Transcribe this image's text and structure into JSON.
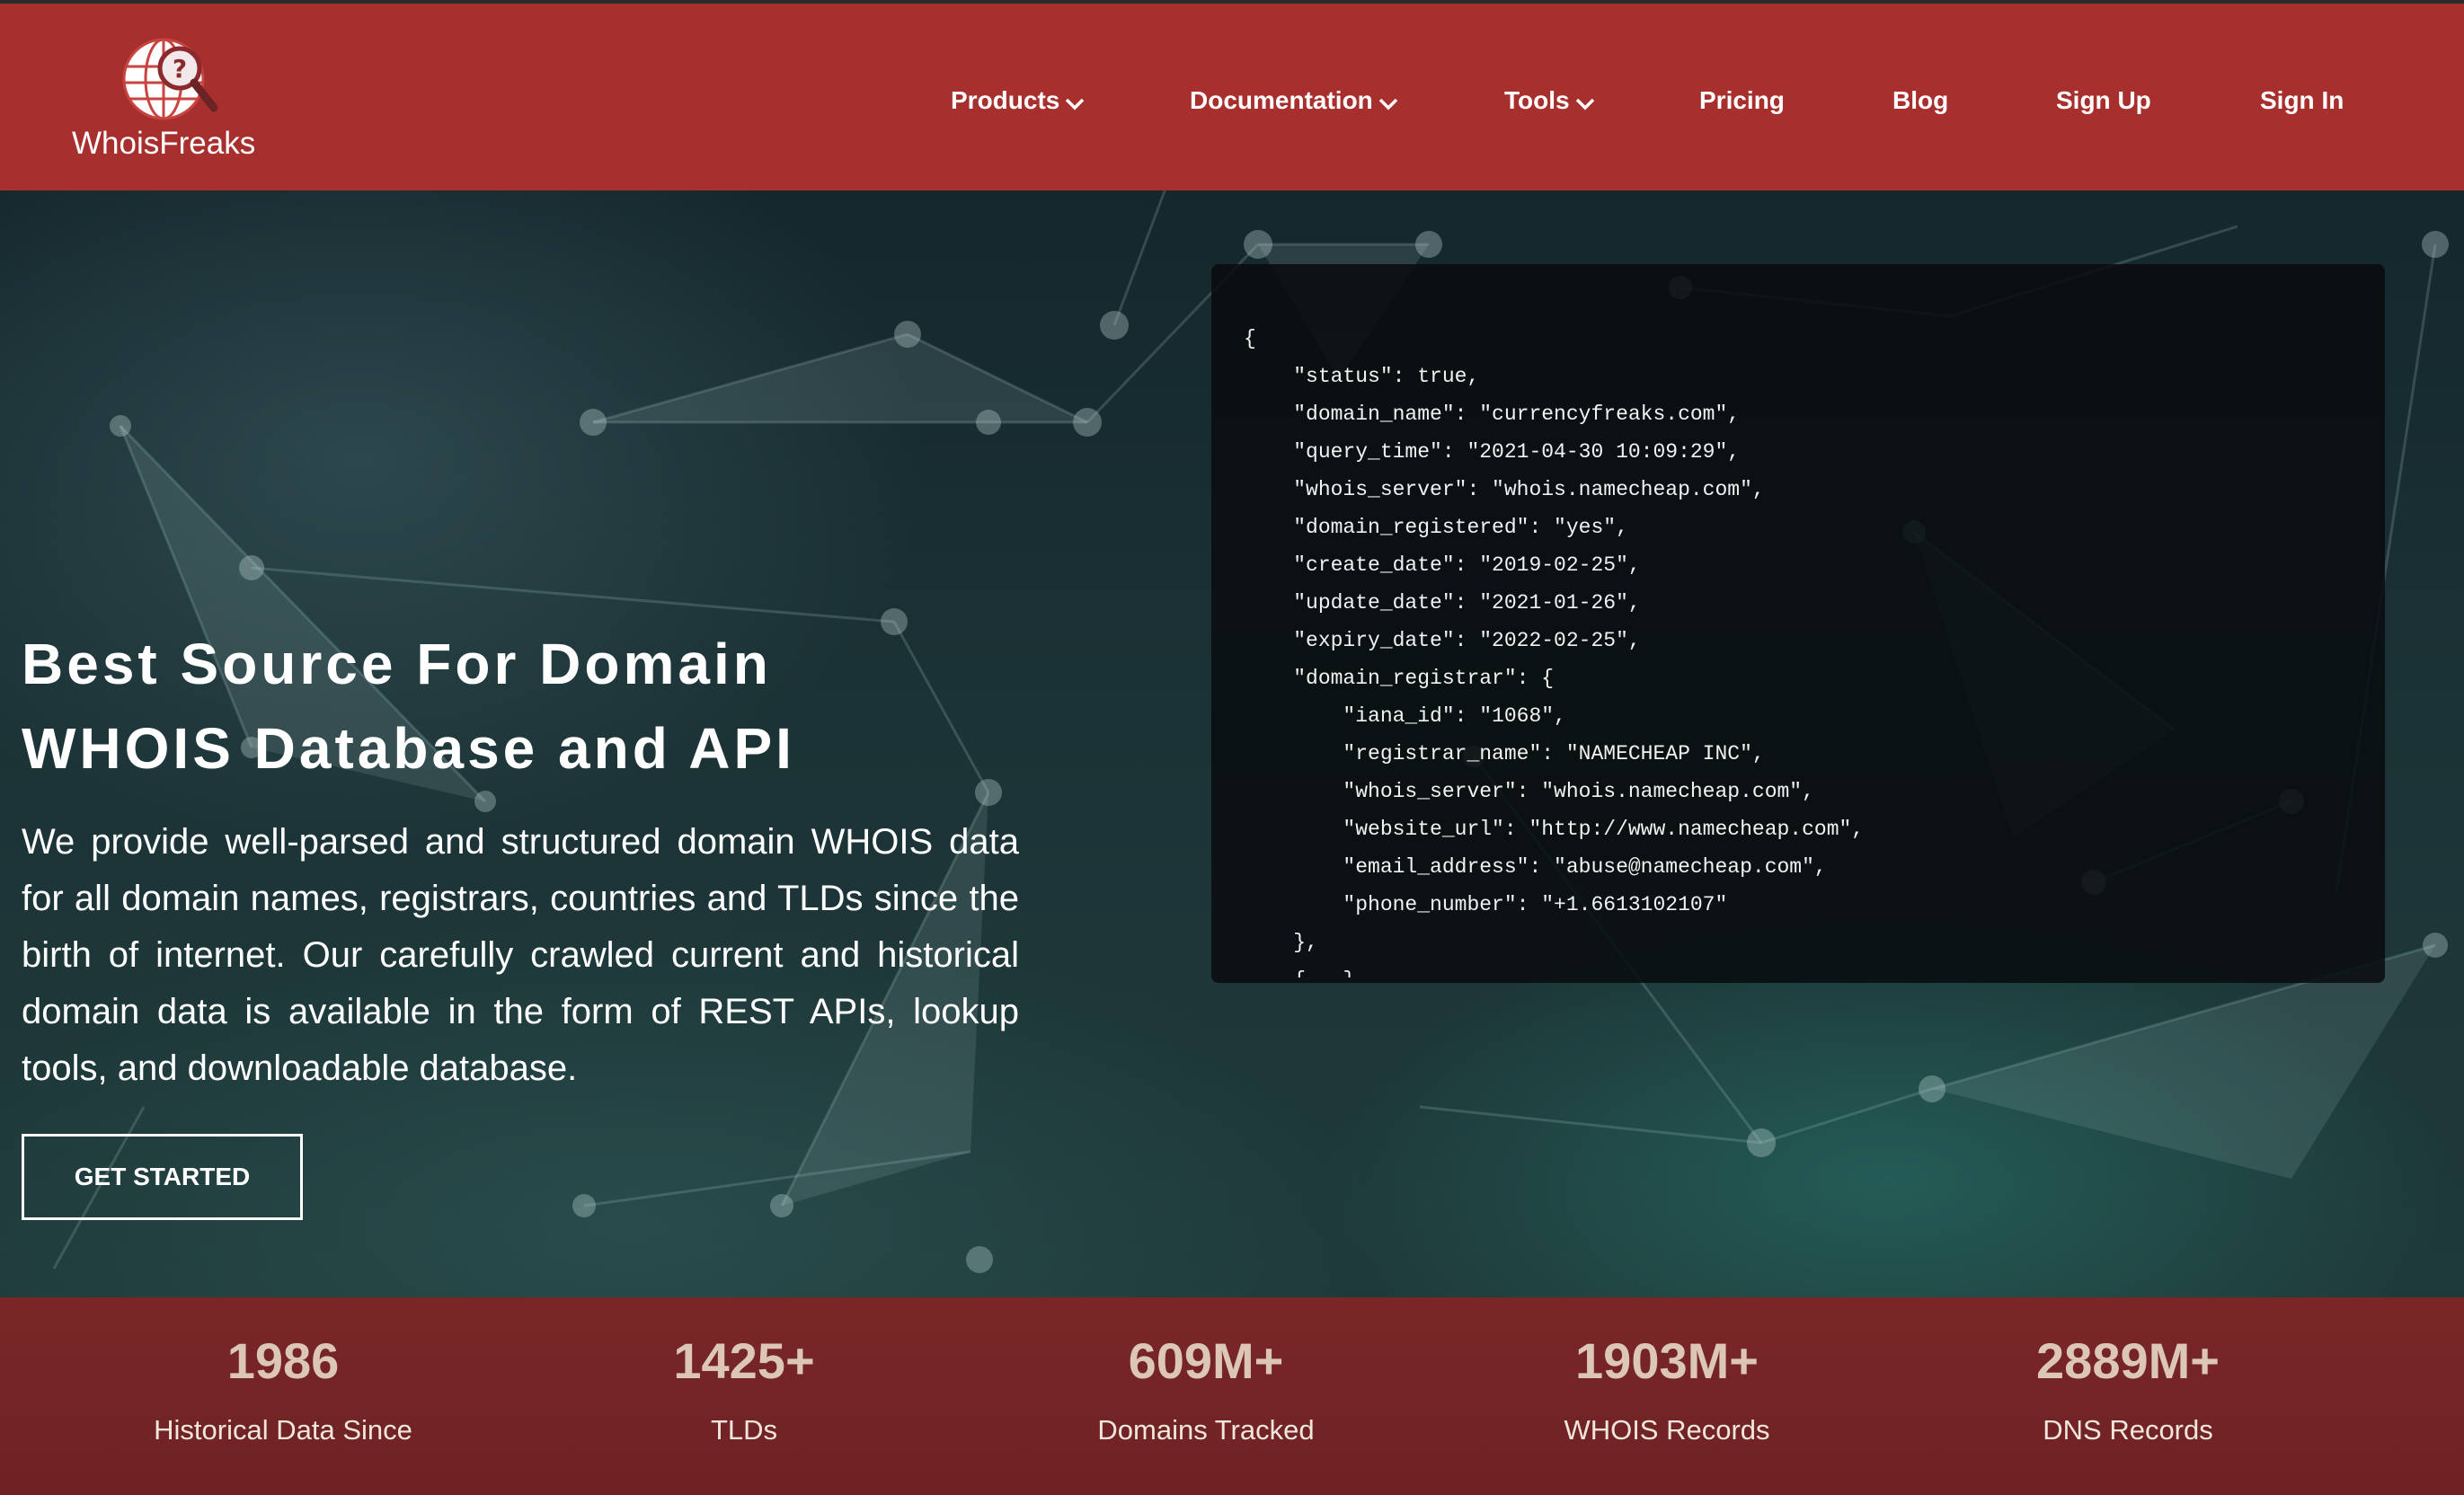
{
  "brand": {
    "name": "WhoisFreaks"
  },
  "colors": {
    "header_bg": "#a7302e",
    "stats_bg": "#7a2627",
    "stat_value": "#dcc7b4"
  },
  "nav": {
    "items": [
      {
        "label": "Products",
        "has_dropdown": true
      },
      {
        "label": "Documentation",
        "has_dropdown": true
      },
      {
        "label": "Tools",
        "has_dropdown": true
      },
      {
        "label": "Pricing",
        "has_dropdown": false
      },
      {
        "label": "Blog",
        "has_dropdown": false
      },
      {
        "label": "Sign Up",
        "has_dropdown": false
      },
      {
        "label": "Sign In",
        "has_dropdown": false
      }
    ]
  },
  "hero": {
    "title_line1": "Best Source For Domain",
    "title_line2": "WHOIS Database and API",
    "description": "We provide well-parsed and structured domain WHOIS data for all domain names, registrars, countries and TLDs since the birth of internet. Our carefully crawled current and historical domain data is available in the form of REST APIs, lookup tools, and downloadable database.",
    "cta_label": "GET STARTED",
    "code_lines": [
      "{",
      "    \"status\": true,",
      "    \"domain_name\": \"currencyfreaks.com\",",
      "    \"query_time\": \"2021-04-30 10:09:29\",",
      "    \"whois_server\": \"whois.namecheap.com\",",
      "    \"domain_registered\": \"yes\",",
      "    \"create_date\": \"2019-02-25\",",
      "    \"update_date\": \"2021-01-26\",",
      "    \"expiry_date\": \"2022-02-25\",",
      "    \"domain_registrar\": {",
      "        \"iana_id\": \"1068\",",
      "        \"registrar_name\": \"NAMECHEAP INC\",",
      "        \"whois_server\": \"whois.namecheap.com\",",
      "        \"website_url\": \"http://www.namecheap.com\",",
      "        \"email_address\": \"abuse@namecheap.com\",",
      "        \"phone_number\": \"+1.6613102107\"",
      "    },",
      "    {...}"
    ]
  },
  "stats": [
    {
      "value": "1986",
      "label": "Historical Data Since"
    },
    {
      "value": "1425+",
      "label": "TLDs"
    },
    {
      "value": "609M+",
      "label": "Domains Tracked"
    },
    {
      "value": "1903M+",
      "label": "WHOIS Records"
    },
    {
      "value": "2889M+",
      "label": "DNS Records"
    }
  ]
}
